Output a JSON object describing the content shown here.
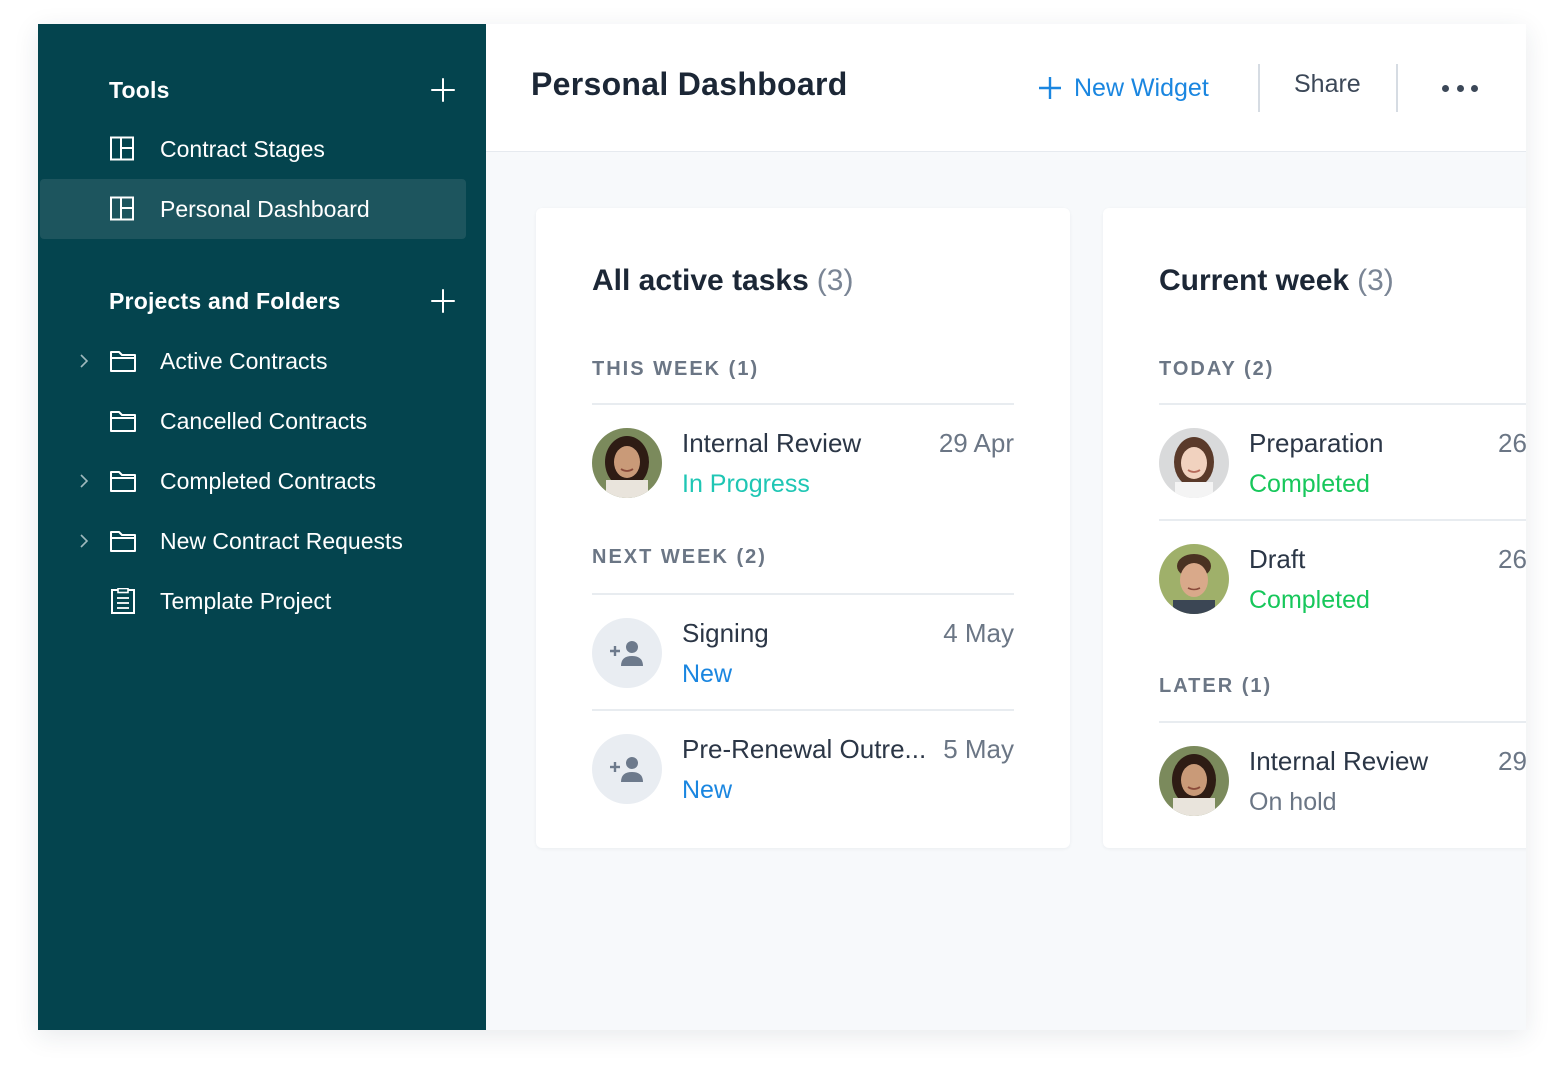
{
  "sidebar": {
    "tools_title": "Tools",
    "tools": [
      {
        "label": "Contract Stages",
        "icon": "dashboard-icon",
        "active": false
      },
      {
        "label": "Personal Dashboard",
        "icon": "dashboard-icon",
        "active": true
      }
    ],
    "projects_title": "Projects and Folders",
    "projects": [
      {
        "label": "Active Contracts",
        "icon": "folder-icon",
        "expandable": true
      },
      {
        "label": "Cancelled Contracts",
        "icon": "folder-icon",
        "expandable": false
      },
      {
        "label": "Completed Contracts",
        "icon": "folder-icon",
        "expandable": true
      },
      {
        "label": "New Contract Requests",
        "icon": "folder-icon",
        "expandable": true
      },
      {
        "label": "Template Project",
        "icon": "clipboard-icon",
        "expandable": false
      }
    ]
  },
  "header": {
    "title": "Personal Dashboard",
    "new_widget_label": "New Widget",
    "share_label": "Share"
  },
  "colors": {
    "sidebar_bg": "#04444e",
    "active_item_bg": "#1d555e",
    "accent_blue": "#1a86e0",
    "status_in_progress": "#1fc6b4",
    "status_completed": "#17c75b",
    "status_new": "#1a86e0",
    "status_on_hold": "#6b7685"
  },
  "widgets": [
    {
      "title": "All active tasks",
      "count": "(3)",
      "groups": [
        {
          "label": "THIS WEEK (1)",
          "tasks": [
            {
              "name": "Internal Review",
              "status": "In Progress",
              "date": "29 Apr",
              "avatar": "woman-dark"
            }
          ]
        },
        {
          "label": "NEXT WEEK (2)",
          "tasks": [
            {
              "name": "Signing",
              "status": "New",
              "date": "4 May",
              "avatar": "unassigned"
            },
            {
              "name": "Pre-Renewal Outre...",
              "status": "New",
              "date": "5 May",
              "avatar": "unassigned"
            }
          ]
        }
      ]
    },
    {
      "title": "Current week",
      "count": "(3)",
      "groups": [
        {
          "label": "TODAY (2)",
          "tasks": [
            {
              "name": "Preparation",
              "status": "Completed",
              "date": "26",
              "avatar": "woman-light"
            },
            {
              "name": "Draft",
              "status": "Completed",
              "date": "26",
              "avatar": "man"
            }
          ]
        },
        {
          "label": "LATER (1)",
          "tasks": [
            {
              "name": "Internal Review",
              "status": "On hold",
              "date": "29",
              "avatar": "woman-dark"
            }
          ]
        }
      ]
    }
  ]
}
